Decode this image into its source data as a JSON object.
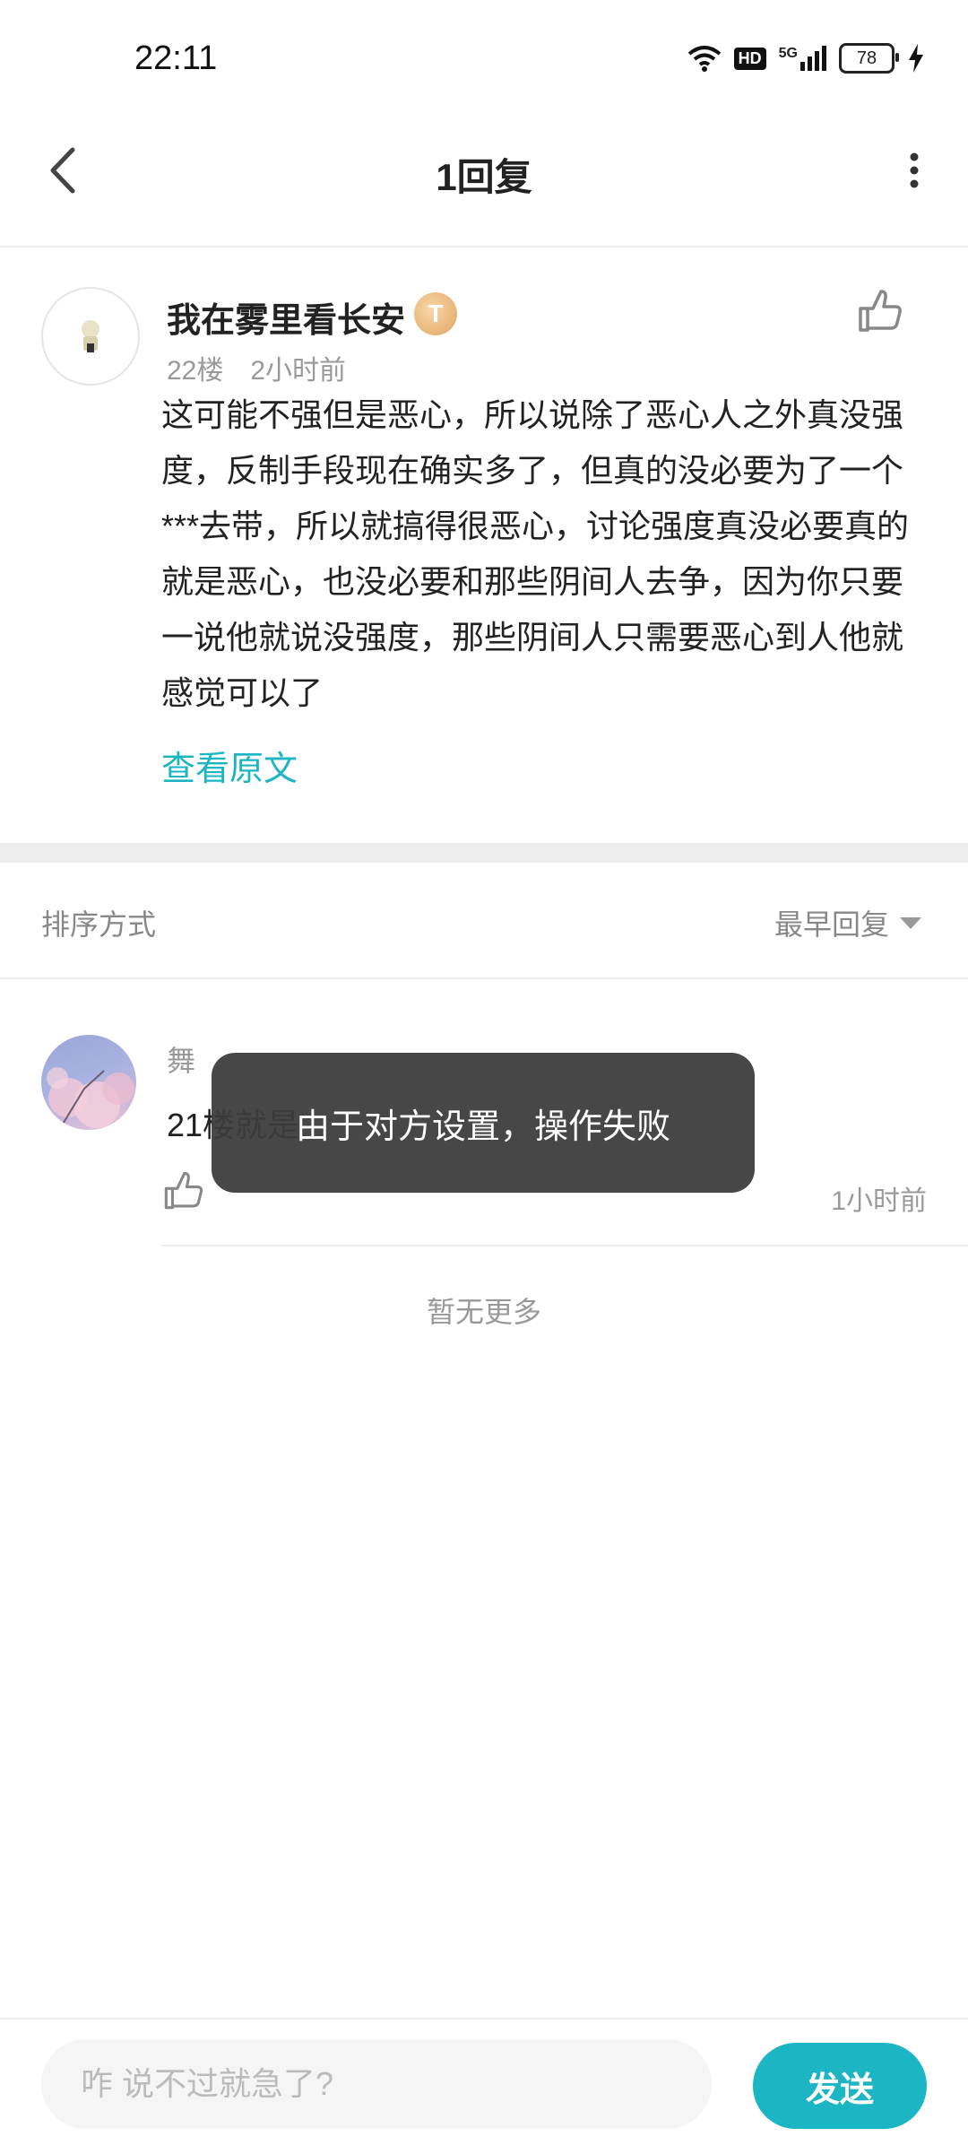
{
  "status_bar": {
    "time": "22:11",
    "hd_label": "HD",
    "network_label": "5G",
    "battery": "78"
  },
  "header": {
    "title": "1回复"
  },
  "post": {
    "username": "我在雾里看长安",
    "medal_letter": "T",
    "floor": "22楼",
    "time": "2小时前",
    "content": "这可能不强但是恶心，所以说除了恶心人之外真没强度，反制手段现在确实多了，但真的没必要为了一个***去带，所以就搞得很恶心，讨论强度真没必要真的就是恶心，也没必要和那些阴间人去争，因为你只要一说他就说没强度，那些阴间人只需要恶心到人他就感觉可以了",
    "view_original": "查看原文"
  },
  "sort": {
    "label": "排序方式",
    "selected": "最早回复"
  },
  "reply": {
    "username": "舞",
    "text": "21楼就是",
    "time": "1小时前"
  },
  "no_more": "暂无更多",
  "toast": "由于对方设置，操作失败",
  "composer": {
    "placeholder": "咋 说不过就急了?",
    "send_label": "发送"
  },
  "colors": {
    "accent": "#1cb5c3",
    "toast_bg": "#3c3c3c"
  }
}
